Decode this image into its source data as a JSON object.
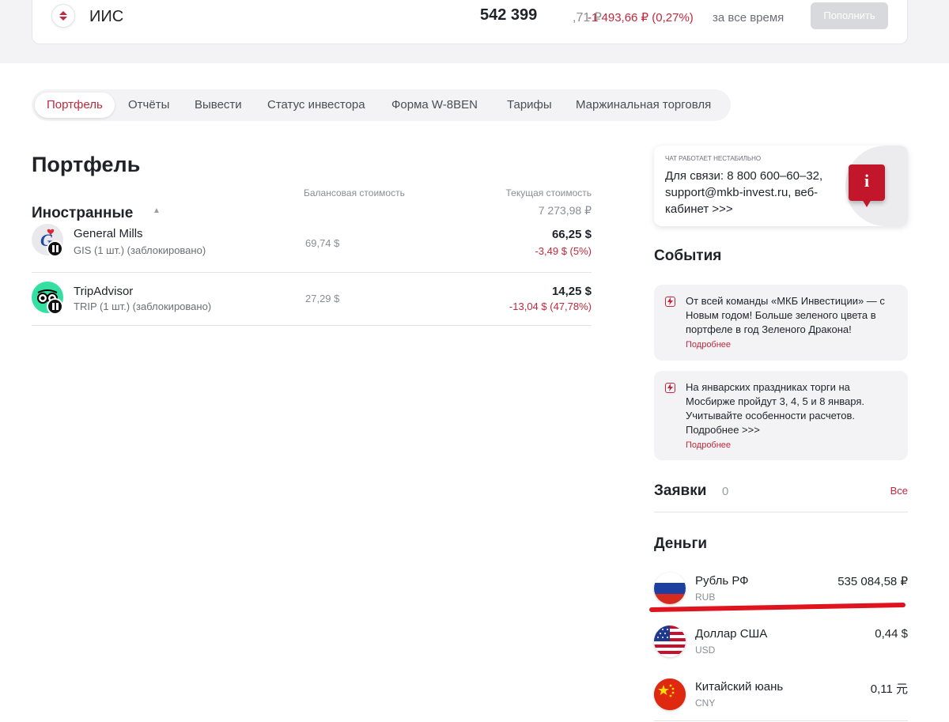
{
  "account": {
    "name": "ИИС",
    "value_main": "542 399",
    "value_cents": ",71 ₽",
    "change": "-1 493,66 ₽ (0,27%)",
    "period": "за все время",
    "topup_label": "Пополнить"
  },
  "tabs": [
    {
      "label": "Портфель",
      "active": true
    },
    {
      "label": "Отчёты"
    },
    {
      "label": "Вывести"
    },
    {
      "label": "Статус инвестора"
    },
    {
      "label": "Форма W-8BEN"
    },
    {
      "label": "Тарифы"
    },
    {
      "label": "Маржинальная торговля"
    }
  ],
  "portfolio": {
    "title": "Портфель",
    "col_balance": "Балансовая стоимость",
    "col_current": "Текущая стоимость",
    "group": {
      "title": "Иностранные",
      "total": "7 273,98 ₽",
      "items": [
        {
          "name": "General Mills",
          "sub": "GIS (1 шт.) (заблокировано)",
          "balance": "69,74 $",
          "current": "66,25 $",
          "change": "-3,49 $ (5%)"
        },
        {
          "name": "TripAdvisor",
          "sub": "TRIP (1 шт.) (заблокировано)",
          "balance": "27,29 $",
          "current": "14,25 $",
          "change": "-13,04 $ (47,78%)"
        }
      ]
    }
  },
  "chat": {
    "tag": "Чат работает нестабильно",
    "text": "Для связи: 8 800 600–60–32, support@mkb-invest.ru, веб-кабинет >>>",
    "badge": "i"
  },
  "events": {
    "title": "События",
    "items": [
      {
        "text": "От всей команды «МКБ Инвестиции» — с Новым годом! Больше зеленого цвета в портфеле в год Зеленого Дракона!",
        "link": "Подробнее"
      },
      {
        "text": "На январских праздниках торги на Мосбирже пройдут 3, 4, 5 и 8 января. Учитывайте особенности расчетов. Подробнее >>>",
        "link": "Подробнее"
      }
    ]
  },
  "orders": {
    "title": "Заявки",
    "count": "0",
    "all_label": "Все"
  },
  "money": {
    "title": "Деньги",
    "items": [
      {
        "name": "Рубль РФ",
        "code": "RUB",
        "value": "535 084,58 ₽"
      },
      {
        "name": "Доллар США",
        "code": "USD",
        "value": "0,44 $"
      },
      {
        "name": "Китайский юань",
        "code": "CNY",
        "value": "0,11 元"
      }
    ]
  },
  "colors": {
    "accent": "#c0283c",
    "annotation": "#e0141f"
  }
}
